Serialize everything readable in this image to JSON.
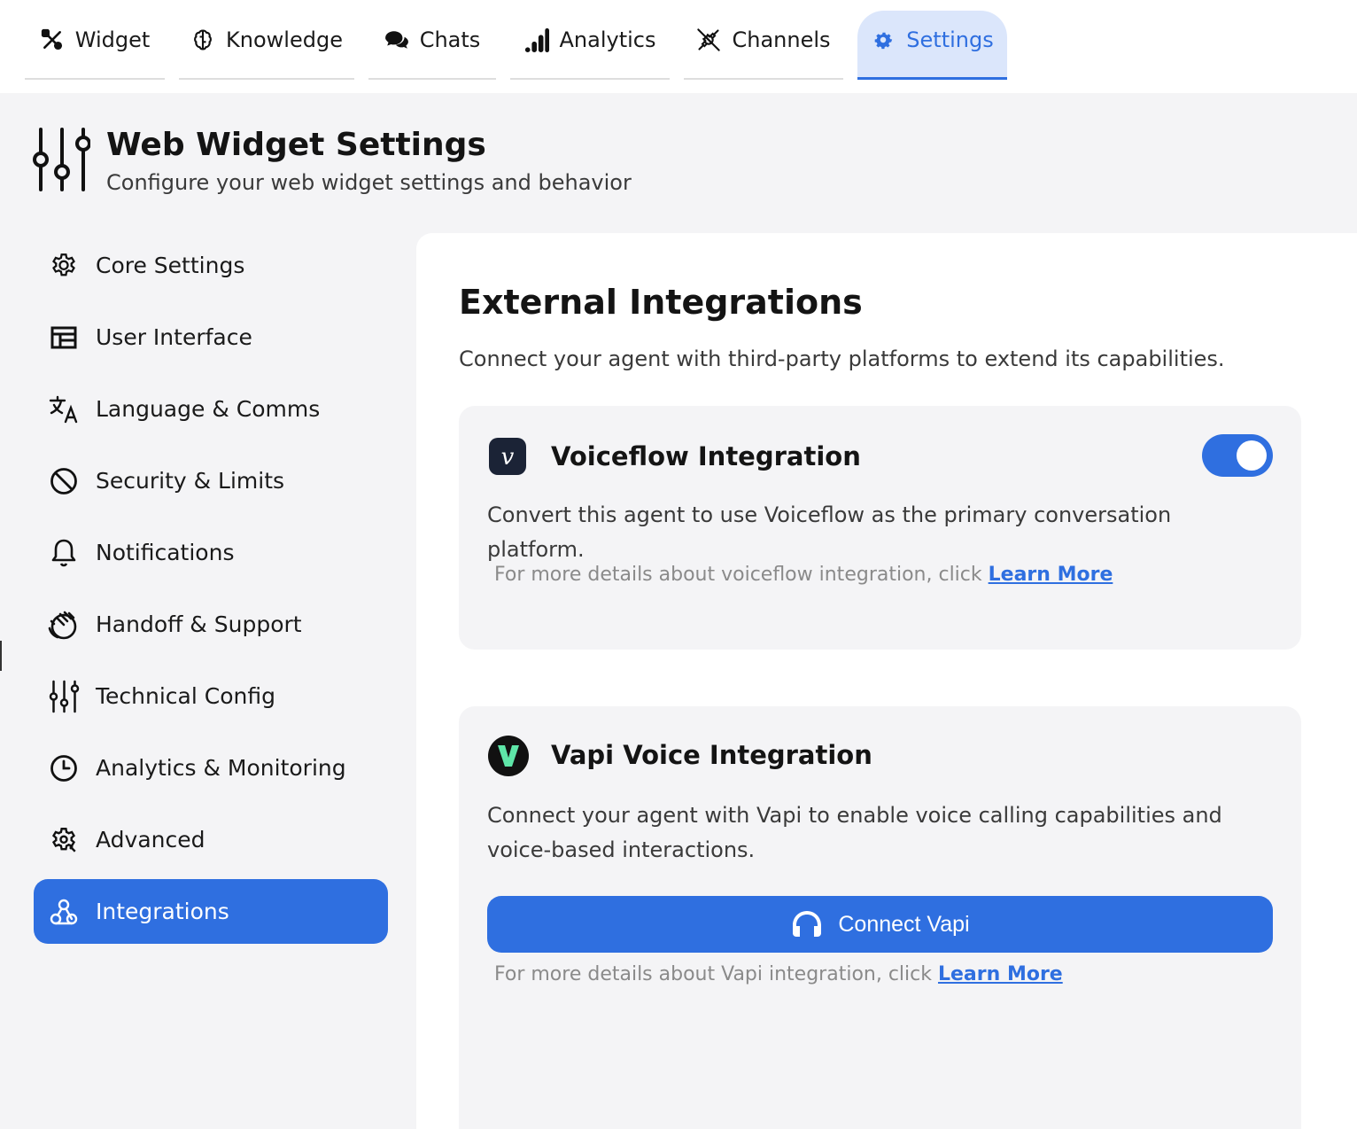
{
  "tabs": [
    {
      "label": "Widget",
      "icon": "tools-icon"
    },
    {
      "label": "Knowledge",
      "icon": "brain-icon"
    },
    {
      "label": "Chats",
      "icon": "chat-bubbles-icon"
    },
    {
      "label": "Analytics",
      "icon": "signal-bars-icon"
    },
    {
      "label": "Channels",
      "icon": "plug-icon"
    },
    {
      "label": "Settings",
      "icon": "gear-icon",
      "active": true
    }
  ],
  "header": {
    "title": "Web Widget Settings",
    "subtitle": "Configure your web widget settings and behavior",
    "icon": "sliders-icon"
  },
  "sidebar": {
    "items": [
      {
        "label": "Core Settings",
        "icon": "gear-outline-icon"
      },
      {
        "label": "User Interface",
        "icon": "layout-icon"
      },
      {
        "label": "Language & Comms",
        "icon": "translate-icon"
      },
      {
        "label": "Security & Limits",
        "icon": "ban-icon"
      },
      {
        "label": "Notifications",
        "icon": "bell-icon"
      },
      {
        "label": "Handoff & Support",
        "icon": "hand-icon"
      },
      {
        "label": "Technical Config",
        "icon": "sliders-icon"
      },
      {
        "label": "Analytics & Monitoring",
        "icon": "clock-icon"
      },
      {
        "label": "Advanced",
        "icon": "gear-advanced-icon"
      },
      {
        "label": "Integrations",
        "icon": "webhook-icon",
        "active": true
      }
    ]
  },
  "main": {
    "title": "External Integrations",
    "description": "Connect your agent with third-party platforms to extend its capabilities.",
    "voiceflow": {
      "title": "Voiceflow Integration",
      "description": "Convert this agent to use Voiceflow as the primary conversation platform.",
      "note": "For more details about voiceflow integration, click ",
      "link": "Learn More",
      "enabled": true,
      "logo_letter": "v"
    },
    "vapi": {
      "title": "Vapi Voice Integration",
      "description": "Connect your agent with Vapi to enable voice calling capabilities and voice-based interactions.",
      "button": "Connect Vapi",
      "note": "For more details about Vapi integration, click ",
      "link": "Learn More"
    }
  },
  "colors": {
    "accent": "#2f6fe0",
    "accent_light": "#dbe6fb",
    "vapi_green": "#5ee6a8"
  }
}
